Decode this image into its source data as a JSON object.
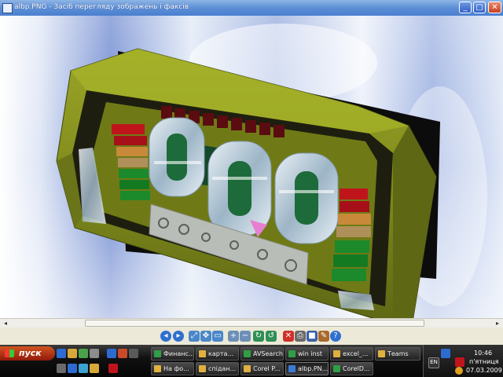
{
  "window": {
    "title": "albp.PNG - Засіб перегляду зображень і факсів",
    "minimize_glyph": "_",
    "maximize_glyph": "□",
    "close_glyph": "✕"
  },
  "scrollbar": {
    "left_arrow": "◂",
    "right_arrow": "▸"
  },
  "toolbar": {
    "buttons": [
      {
        "icon": "previous-icon",
        "glyph": "◂"
      },
      {
        "icon": "next-icon",
        "glyph": "▸"
      },
      {
        "icon": "best-fit-icon",
        "glyph": "⤢"
      },
      {
        "icon": "actual-size-icon",
        "glyph": "✥"
      },
      {
        "icon": "slideshow-icon",
        "glyph": "▭"
      },
      {
        "icon": "zoom-in-icon",
        "glyph": "+"
      },
      {
        "icon": "zoom-out-icon",
        "glyph": "−"
      },
      {
        "icon": "rotate-cw-icon",
        "glyph": "↻"
      },
      {
        "icon": "rotate-ccw-icon",
        "glyph": "↺"
      },
      {
        "icon": "delete-icon",
        "glyph": "✕"
      },
      {
        "icon": "print-icon",
        "glyph": "⎙"
      },
      {
        "icon": "save-icon",
        "glyph": "■"
      },
      {
        "icon": "edit-icon",
        "glyph": "✎"
      },
      {
        "icon": "help-icon",
        "glyph": "?"
      }
    ]
  },
  "taskbar": {
    "start_label": "пуск",
    "tasks_row1": [
      {
        "label": "Финанс...",
        "color": "#2f9e45"
      },
      {
        "label": "картa...",
        "color": "#e0b040"
      },
      {
        "label": "AVSearch",
        "color": "#2f9e45"
      },
      {
        "label": "win inst",
        "color": "#2f9e45"
      },
      {
        "label": "excel_...",
        "color": "#e0b040"
      },
      {
        "label": "Тeams",
        "color": "#e0b040"
      }
    ],
    "tasks_row2": [
      {
        "label": "На фо...",
        "color": "#e0b040"
      },
      {
        "label": "спідан...",
        "color": "#e0b040"
      },
      {
        "label": "Corel P...",
        "color": "#e0b040"
      },
      {
        "label": "albp.PN...",
        "color": "#3a7bd5"
      },
      {
        "label": "CorelD...",
        "color": "#2f9e45"
      }
    ],
    "language": "EN",
    "time": "10:46",
    "day": "п'ятниця",
    "date": "07.03.2009"
  },
  "colors": {
    "bezel": "#7f8a1c",
    "bezel_dark": "#4c5410",
    "bezel_light": "#a8b52a",
    "digit_glass": "#c9dbe6",
    "digit_inner": "#1d6b3a",
    "led_red": "#c0141c",
    "led_green": "#1c8a2a",
    "led_yellow": "#c8a040"
  }
}
